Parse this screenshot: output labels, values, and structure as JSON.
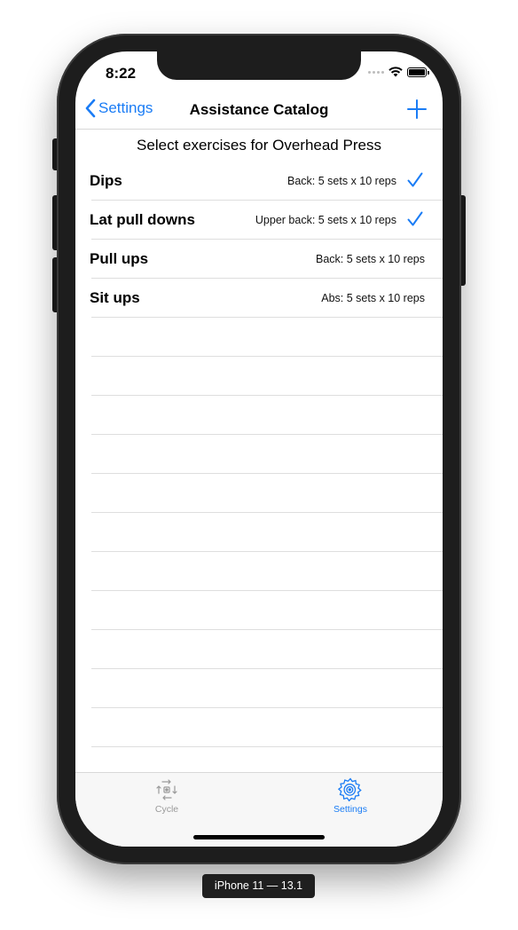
{
  "status_bar": {
    "time": "8:22",
    "signal_icon": "signal-dots-icon",
    "wifi_icon": "wifi-icon",
    "battery_icon": "battery-icon"
  },
  "navbar": {
    "back_label": "Settings",
    "back_icon": "chevron-left-icon",
    "title": "Assistance Catalog",
    "add_icon": "plus-icon"
  },
  "section_header": "Select exercises for Overhead Press",
  "exercises": [
    {
      "name": "Dips",
      "detail": "Back: 5 sets x 10 reps",
      "selected": true
    },
    {
      "name": "Lat pull downs",
      "detail": "Upper back: 5 sets x 10 reps",
      "selected": true
    },
    {
      "name": "Pull ups",
      "detail": "Back: 5 sets x 10 reps",
      "selected": false
    },
    {
      "name": "Sit ups",
      "detail": "Abs: 5 sets x 10 reps",
      "selected": false
    }
  ],
  "tabbar": {
    "tabs": [
      {
        "label": "Cycle",
        "icon": "cycle-icon",
        "active": false
      },
      {
        "label": "Settings",
        "icon": "gear-icon",
        "active": true
      }
    ]
  },
  "device_caption": "iPhone 11 — 13.1",
  "colors": {
    "accent": "#1a7cf5",
    "inactive_tab": "#9a9a9a",
    "separator": "#dedede"
  }
}
